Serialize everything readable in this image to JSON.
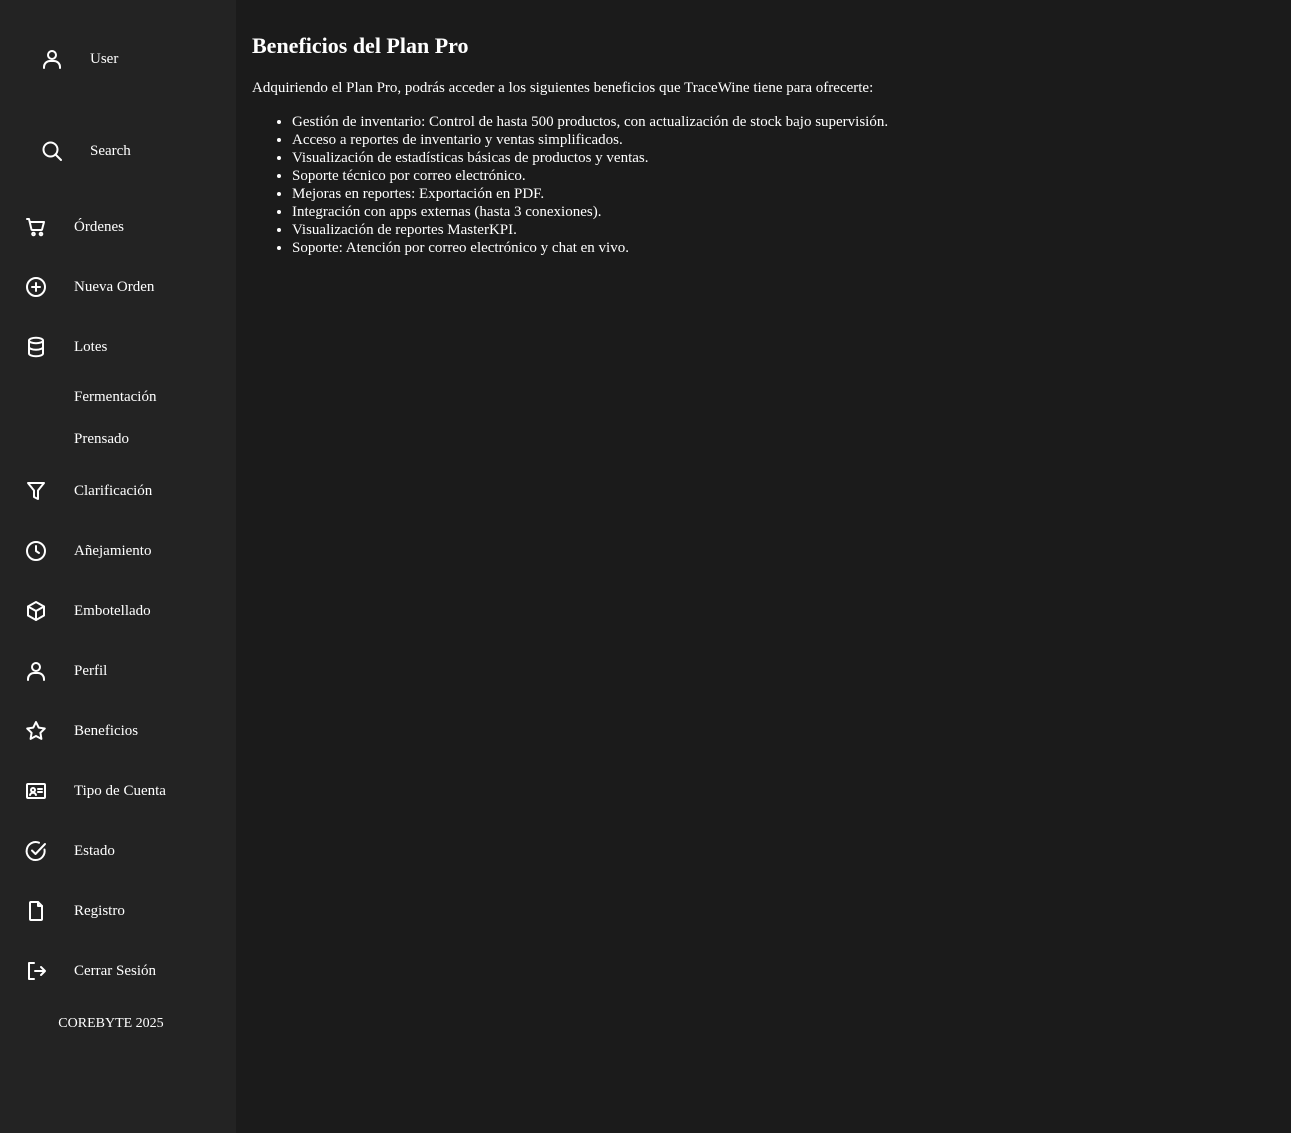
{
  "sidebar": {
    "user_label": "User",
    "search_label": "Search",
    "items": [
      {
        "label": "Órdenes",
        "icon": "cart-icon"
      },
      {
        "label": "Nueva Orden",
        "icon": "plus-circle-icon"
      },
      {
        "label": "Lotes",
        "icon": "database-icon"
      },
      {
        "label": "Clarificación",
        "icon": "filter-icon"
      },
      {
        "label": "Añejamiento",
        "icon": "clock-icon"
      },
      {
        "label": "Embotellado",
        "icon": "box-icon"
      },
      {
        "label": "Perfil",
        "icon": "user-icon"
      },
      {
        "label": "Beneficios",
        "icon": "star-icon"
      },
      {
        "label": "Tipo de Cuenta",
        "icon": "id-card-icon"
      },
      {
        "label": "Estado",
        "icon": "check-circle-icon"
      },
      {
        "label": "Registro",
        "icon": "file-icon"
      },
      {
        "label": "Cerrar Sesión",
        "icon": "logout-icon"
      }
    ],
    "sub_items": [
      "Fermentación",
      "Prensado"
    ],
    "footer": "COREBYTE 2025"
  },
  "main": {
    "title": "Beneficios del Plan Pro",
    "intro": "Adquiriendo el Plan Pro, podrás acceder a los siguientes beneficios que TraceWine tiene para ofrecerte:",
    "benefits": [
      "Gestión de inventario: Control de hasta 500 productos, con actualización de stock bajo supervisión.",
      "Acceso a reportes de inventario y ventas simplificados.",
      "Visualización de estadísticas básicas de productos y ventas.",
      "Soporte técnico por correo electrónico.",
      "Mejoras en reportes: Exportación en PDF.",
      "Integración con apps externas (hasta 3 conexiones).",
      "Visualización de reportes MasterKPI.",
      "Soporte: Atención por correo electrónico y chat en vivo."
    ]
  },
  "colors": {
    "sidebar_bg": "#232323",
    "main_bg": "#1b1b1b",
    "text": "#ffffff"
  }
}
